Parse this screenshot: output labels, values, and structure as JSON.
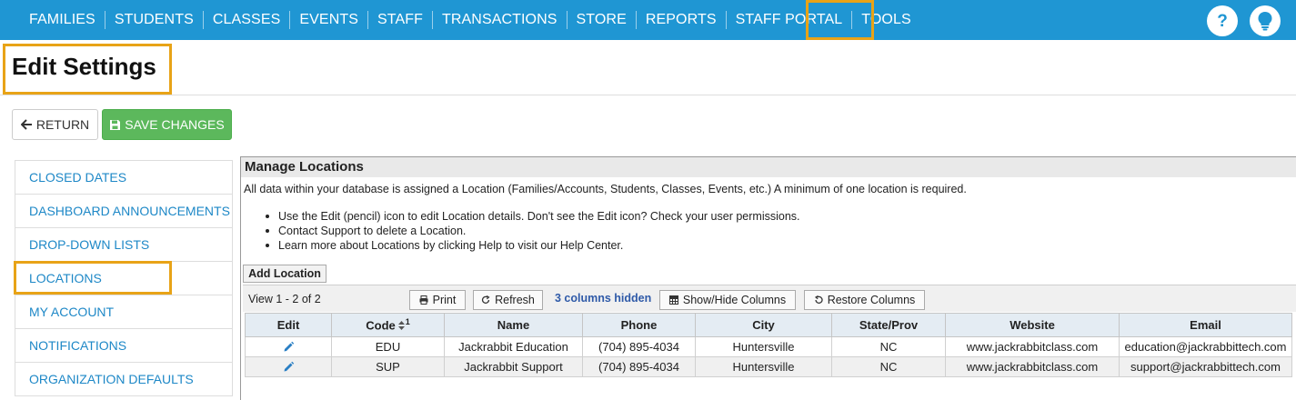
{
  "nav": {
    "items": [
      "FAMILIES",
      "STUDENTS",
      "CLASSES",
      "EVENTS",
      "STAFF",
      "TRANSACTIONS",
      "STORE",
      "REPORTS",
      "STAFF PORTAL",
      "TOOLS"
    ],
    "help_icon": "question-icon",
    "tip_icon": "lightbulb-icon",
    "bg_color": "#1f96d3",
    "highlight_color": "#e8a317"
  },
  "header": {
    "title": "Edit Settings"
  },
  "actions": {
    "return_label": "RETURN",
    "save_label": "SAVE CHANGES",
    "save_color": "#5cb85c"
  },
  "side_menu": {
    "items": [
      "CLOSED DATES",
      "DASHBOARD ANNOUNCEMENTS",
      "DROP-DOWN LISTS",
      "LOCATIONS",
      "MY ACCOUNT",
      "NOTIFICATIONS",
      "ORGANIZATION DEFAULTS"
    ],
    "selected": "LOCATIONS",
    "link_color": "#1e88c7"
  },
  "panel": {
    "title": "Manage Locations",
    "description": "All data within your database is assigned a Location (Families/Accounts, Students, Classes, Events, etc.) A minimum of one location is required.",
    "bullets": [
      "Use the Edit (pencil) icon to edit Location details. Don't see the Edit icon? Check your user permissions.",
      "Contact Support to delete a Location.",
      "Learn more about Locations by clicking Help to visit our Help Center."
    ],
    "add_label": "Add Location"
  },
  "grid": {
    "view_count": "View 1 - 2 of 2",
    "print_label": "Print",
    "refresh_label": "Refresh",
    "hidden_columns": "3 columns hidden",
    "show_hide_label": "Show/Hide Columns",
    "restore_label": "Restore Columns",
    "columns": [
      "Edit",
      "Code",
      "Name",
      "Phone",
      "City",
      "State/Prov",
      "Website",
      "Email"
    ],
    "sort_index": "1",
    "rows": [
      [
        "",
        "EDU",
        "Jackrabbit Education",
        "(704) 895-4034",
        "Huntersville",
        "NC",
        "www.jackrabbitclass.com",
        "education@jackrabbittech.com"
      ],
      [
        "",
        "SUP",
        "Jackrabbit Support",
        "(704) 895-4034",
        "Huntersville",
        "NC",
        "www.jackrabbitclass.com",
        "support@jackrabbittech.com"
      ]
    ]
  }
}
